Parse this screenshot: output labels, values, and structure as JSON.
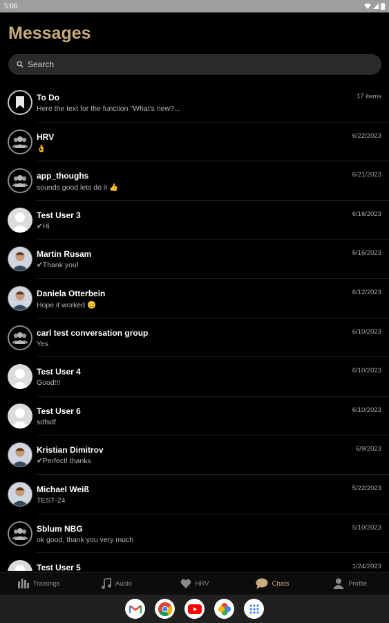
{
  "status_bar": {
    "time": "5:06"
  },
  "header": {
    "title": "Messages"
  },
  "search": {
    "placeholder": "Search"
  },
  "conversations": [
    {
      "name": "To Do",
      "preview": "Here the text for the function \"What's new?...",
      "date": "17 items",
      "avatar": "todo-icon"
    },
    {
      "name": "HRV",
      "preview": "👌",
      "date": "6/22/2023",
      "avatar": "group-icon"
    },
    {
      "name": "app_thoughs",
      "preview": "sounds good lets do it 👍",
      "date": "6/21/2023",
      "avatar": "group-icon"
    },
    {
      "name": "Test User 3",
      "preview": "✔Hi",
      "date": "6/16/2023",
      "avatar": "user-icon"
    },
    {
      "name": "Martin Rusam",
      "preview": "✔Thank you!",
      "date": "6/16/2023",
      "avatar": "photo"
    },
    {
      "name": "Daniela Otterbein",
      "preview": "Hope it worked 😊",
      "date": "6/12/2023",
      "avatar": "photo"
    },
    {
      "name": "carl test conversation group",
      "preview": "Yes",
      "date": "6/10/2023",
      "avatar": "group-icon"
    },
    {
      "name": "Test User 4",
      "preview": "Good!!!",
      "date": "6/10/2023",
      "avatar": "user-icon"
    },
    {
      "name": "Test User 6",
      "preview": "sdfsdf",
      "date": "6/10/2023",
      "avatar": "user-icon"
    },
    {
      "name": "Kristian Dimitrov",
      "preview": "✔Perfect! thanks",
      "date": "6/9/2023",
      "avatar": "photo"
    },
    {
      "name": "Michael Weiß",
      "preview": "TEST-24",
      "date": "5/22/2023",
      "avatar": "photo"
    },
    {
      "name": "Sblum NBG",
      "preview": "ok good, thank you very much",
      "date": "5/10/2023",
      "avatar": "group-icon"
    },
    {
      "name": "Test User 5",
      "preview": "",
      "date": "1/24/2023",
      "avatar": "user-icon"
    }
  ],
  "bottom_nav": [
    {
      "label": "Trainings",
      "icon": "bar-chart-icon"
    },
    {
      "label": "Audio",
      "icon": "music-note-icon"
    },
    {
      "label": "HRV",
      "icon": "heart-icon"
    },
    {
      "label": "Chats",
      "icon": "chat-bubble-icon",
      "active": true
    },
    {
      "label": "Profile",
      "icon": "person-icon"
    }
  ],
  "colors": {
    "accent": "#c9ac7c",
    "background": "#000000"
  },
  "taskbar_apps": [
    "gmail-icon",
    "chrome-icon",
    "youtube-icon",
    "photos-icon",
    "app-drawer-icon"
  ]
}
